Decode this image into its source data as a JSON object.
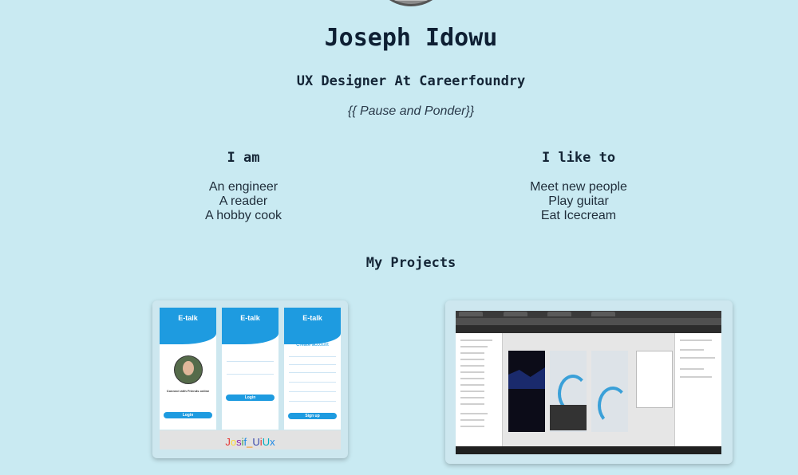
{
  "profile": {
    "name": "Joseph Idowu",
    "role": "UX Designer At Careerfoundry",
    "quote": "{{ Pause and Ponder}}"
  },
  "i_am": {
    "heading": "I am",
    "items": [
      "An engineer",
      "A reader",
      "A hobby cook"
    ]
  },
  "i_like": {
    "heading": "I like to",
    "items": [
      "Meet new people",
      "Play guitar",
      "Eat Icecream"
    ]
  },
  "projects": {
    "heading": "My Projects",
    "etalk": {
      "app_name": "E-talk",
      "screen3_title": "Create account",
      "login_label": "Login",
      "signup_label": "Sign up",
      "connect_text": "Connect with Friends online",
      "brand_letters": [
        "J",
        "o",
        "s",
        "i",
        "f",
        "_",
        "U",
        "i",
        "U",
        "x"
      ]
    }
  },
  "colors": {
    "background": "#c9eaf2",
    "accent": "#1e9be0"
  }
}
